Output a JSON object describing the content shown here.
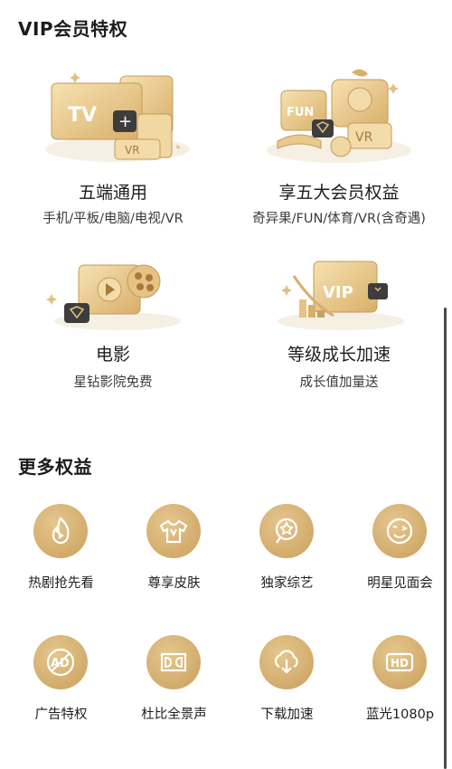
{
  "vip_section": {
    "title": "VIP会员特权",
    "features": [
      {
        "name": "五端通用",
        "desc": "手机/平板/电脑/电视/VR",
        "tv_text": "TV",
        "vr_text": "VR"
      },
      {
        "name": "享五大会员权益",
        "desc": "奇异果/FUN/体育/VR(含奇遇)",
        "fun_text": "FUN",
        "vr_text": "VR"
      },
      {
        "name": "电影",
        "desc": "星钻影院免费"
      },
      {
        "name": "等级成长加速",
        "desc": "成长值加量送",
        "vip_text": "VIP"
      }
    ]
  },
  "more_section": {
    "title": "更多权益",
    "perks": [
      {
        "label": "热剧抢先看",
        "icon": "flame-play-icon"
      },
      {
        "label": "尊享皮肤",
        "icon": "tshirt-icon"
      },
      {
        "label": "独家综艺",
        "icon": "star-microphone-icon"
      },
      {
        "label": "明星见面会",
        "icon": "wink-face-icon"
      },
      {
        "label": "广告特权",
        "icon": "no-ad-icon",
        "icon_text": "AD"
      },
      {
        "label": "杜比全景声",
        "icon": "dolby-icon"
      },
      {
        "label": "下载加速",
        "icon": "download-icon"
      },
      {
        "label": "蓝光1080p",
        "icon": "hd-icon",
        "icon_text": "HD"
      }
    ]
  },
  "colors": {
    "gold": "#d2ab6b",
    "gold_light": "#f3dcaa",
    "gold_dark": "#a8793b",
    "dark_badge": "#3d3d3d"
  }
}
